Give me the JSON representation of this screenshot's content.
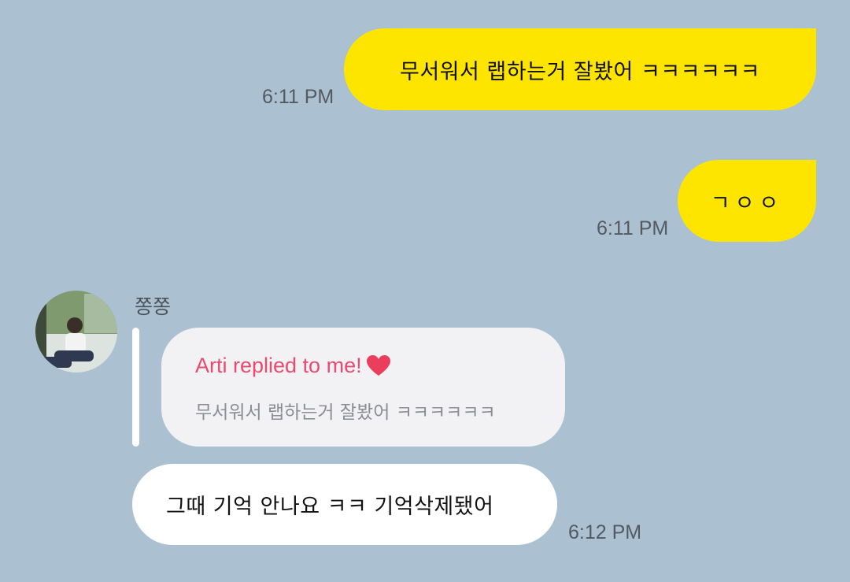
{
  "messages": {
    "sent_1": {
      "text": "무서워서 랩하는거 잘봤어 ㅋㅋㅋㅋㅋㅋ",
      "time": "6:11 PM"
    },
    "sent_2": {
      "text": "ㄱㅇㅇ",
      "time": "6:11 PM"
    },
    "received": {
      "sender": "쫑쫑",
      "avatar_icon": "profile-photo",
      "reply": {
        "title": "Arti replied to me!",
        "heart_icon": "heart-icon",
        "quote": "무서워서 랩하는거 잘봤어 ㅋㅋㅋㅋㅋㅋ"
      },
      "text": "그때 기억 안나요 ㅋㅋ 기억삭제됐어",
      "time": "6:12 PM"
    }
  },
  "colors": {
    "background": "#abc1d1",
    "sent_bubble": "#fee500",
    "received_bubble": "#ffffff",
    "reply_card": "#f2f2f5",
    "reply_title": "#e94a6f",
    "heart": "#ea3e5c"
  }
}
